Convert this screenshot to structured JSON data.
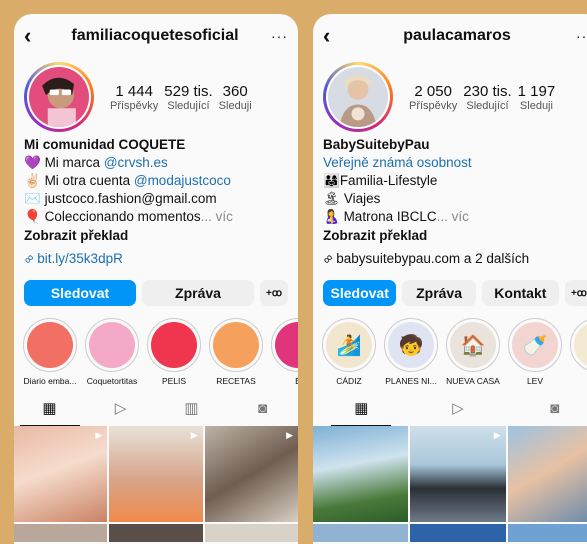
{
  "left": {
    "username": "familiacoquetesoficial",
    "stats": [
      {
        "num": "1 444",
        "label": "Příspěvky"
      },
      {
        "num": "529 tis.",
        "label": "Sledující"
      },
      {
        "num": "360",
        "label": "Sleduji"
      }
    ],
    "name": "Mi comunidad COQUETE",
    "bio_lines": [
      {
        "emoji": "💜",
        "text": " Mi marca ",
        "link": "@crvsh.es",
        "more": ""
      },
      {
        "emoji": "✌🏻",
        "text": " Mi otra cuenta ",
        "link": "@modajustcoco",
        "more": ""
      },
      {
        "emoji": "✉️",
        "text": " justcoco.fashion@gmail.com",
        "link": "",
        "more": ""
      },
      {
        "emoji": "🎈",
        "text": " Coleccionando momentos",
        "link": "",
        "more": "... víc"
      }
    ],
    "translate": "Zobrazit překlad",
    "link": "bit.ly/35k3dpR",
    "buttons": {
      "follow": "Sledovat",
      "message": "Zpráva",
      "suggest": "+ꝏ"
    },
    "highlights": [
      {
        "label": "Diario emba...",
        "color": "#f26f63"
      },
      {
        "label": "Coquetortitas",
        "color": "#f5a9c8"
      },
      {
        "label": "PELIS",
        "color": "#f0354f"
      },
      {
        "label": "RECETAS",
        "color": "#f5a05c"
      },
      {
        "label": "B",
        "color": "#e0357b"
      }
    ]
  },
  "right": {
    "username": "paulacamaros",
    "stats": [
      {
        "num": "2 050",
        "label": "Příspěvky"
      },
      {
        "num": "230 tis.",
        "label": "Sledující"
      },
      {
        "num": "1 197",
        "label": "Sleduji"
      }
    ],
    "name": "BabySuitebyPau",
    "category": "Veřejně známá osobnost",
    "bio_lines": [
      {
        "emoji": "👨‍👩‍👧",
        "text": "Familia-Lifestyle",
        "more": ""
      },
      {
        "emoji": "🏝",
        "text": " Viajes",
        "more": ""
      },
      {
        "emoji": "🤱",
        "text": " Matrona IBCLC",
        "more": "... víc"
      }
    ],
    "translate": "Zobrazit překlad",
    "link": "babysuitebypau.com a 2 dalších",
    "buttons": {
      "follow": "Sledovat",
      "message": "Zpráva",
      "contact": "Kontakt",
      "suggest": "+ꝏ"
    },
    "highlights": [
      {
        "label": "CÁDIZ",
        "color": "#f3e6cf",
        "icon": "🏄"
      },
      {
        "label": "PLANES NI...",
        "color": "#dfe3f2",
        "icon": "🧒"
      },
      {
        "label": "NUEVA CASA",
        "color": "#e9e3dc",
        "icon": "🏠"
      },
      {
        "label": "LEV",
        "color": "#f2d5d0",
        "icon": "🍼"
      },
      {
        "label": "I",
        "color": "#f4ead4",
        "icon": ""
      }
    ]
  },
  "icons": {
    "back": "‹",
    "more": "···",
    "grid": "▦",
    "reels": "▷",
    "guides": "▥",
    "tagged": "◙",
    "link": "∞",
    "reel_badge": "▶"
  }
}
